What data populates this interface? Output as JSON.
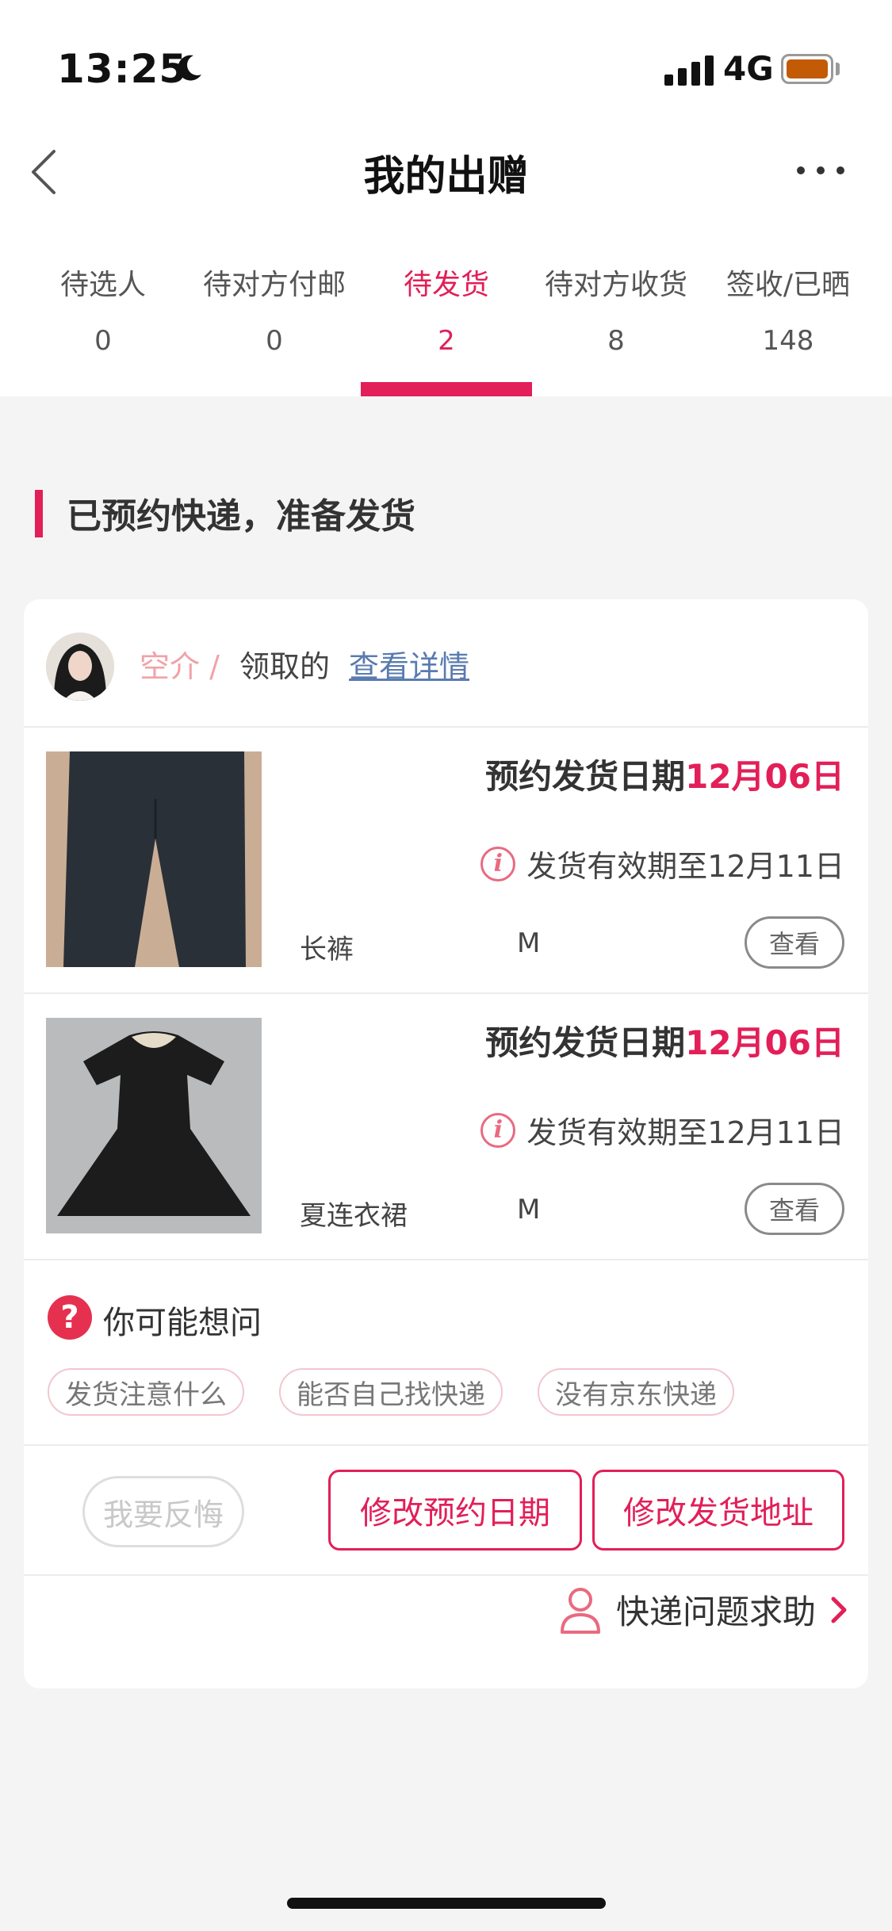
{
  "status_bar": {
    "time": "13:25",
    "network": "4G"
  },
  "nav": {
    "title": "我的出赠"
  },
  "tabs": [
    {
      "label": "待选人",
      "count": "0"
    },
    {
      "label": "待对方付邮",
      "count": "0"
    },
    {
      "label": "待发货",
      "count": "2"
    },
    {
      "label": "待对方收货",
      "count": "8"
    },
    {
      "label": "签收/已晒",
      "count": "148"
    }
  ],
  "active_tab_index": 2,
  "section": {
    "title": "已预约快递，准备发货"
  },
  "order": {
    "user_name": "空介 /",
    "received_text": "领取的",
    "detail_link": "查看详情"
  },
  "items": [
    {
      "ship_label": "预约发货日期",
      "ship_date": "12月06日",
      "valid_text": "发货有效期至12月11日",
      "name": "长裤",
      "size": "M",
      "view_label": "查看",
      "image": "black-trousers"
    },
    {
      "ship_label": "预约发货日期",
      "ship_date": "12月06日",
      "valid_text": "发货有效期至12月11日",
      "name": "夏连衣裙",
      "size": "M",
      "view_label": "查看",
      "image": "black-dress"
    }
  ],
  "faq": {
    "title": "你可能想问",
    "icon": "?",
    "chips": [
      "发货注意什么",
      "能否自己找快递",
      "没有京东快递"
    ]
  },
  "actions": {
    "regret": "我要反悔",
    "change_date": "修改预约日期",
    "change_address": "修改发货地址"
  },
  "help": {
    "label": "快递问题求助"
  },
  "colors": {
    "accent": "#e21f58",
    "user_name": "#f0a3a8",
    "link": "#5a7bb0",
    "battery": "#c25a06"
  }
}
